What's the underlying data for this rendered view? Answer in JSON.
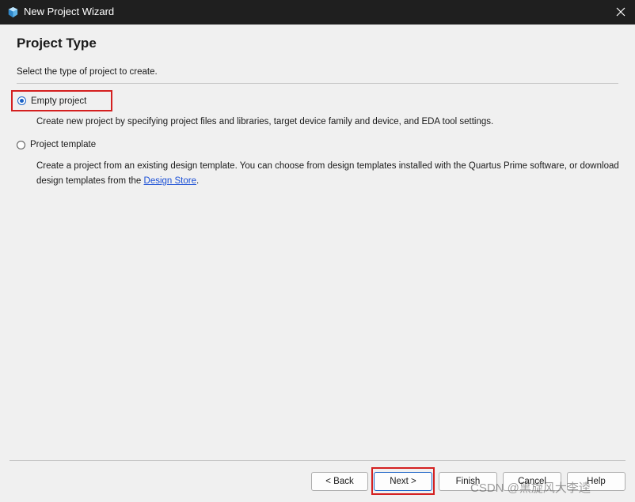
{
  "window": {
    "title": "New Project Wizard",
    "icon": "quartus-app-icon"
  },
  "page": {
    "title": "Project Type",
    "instruction": "Select the type of project to create."
  },
  "options": [
    {
      "label": "Empty project",
      "selected": true,
      "description": "Create new project by specifying project files and libraries, target device family and device, and EDA tool settings."
    },
    {
      "label": "Project template",
      "selected": false,
      "description_before_link": "Create a project from an existing design template. You can choose from design templates installed with the Quartus Prime software, or download design templates from the ",
      "link_text": "Design Store",
      "description_after_link": "."
    }
  ],
  "buttons": {
    "back": "< Back",
    "next": "Next >",
    "finish": "Finish",
    "cancel": "Cancel",
    "help": "Help"
  },
  "watermark": "CSDN @黑旋风大李逵",
  "colors": {
    "titlebar": "#1f1f1f",
    "accent": "#1a62c6",
    "highlight": "#d42020",
    "link": "#1a4fd6"
  }
}
